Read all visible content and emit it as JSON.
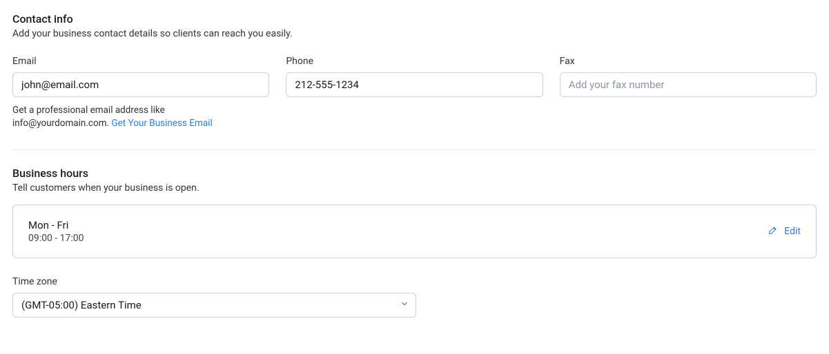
{
  "contact": {
    "title": "Contact info",
    "desc": "Add your business contact details so clients can reach you easily.",
    "email": {
      "label": "Email",
      "value": "john@email.com",
      "helper_prefix": "Get a professional email address like info@yourdomain.com. ",
      "helper_link": "Get Your Business Email"
    },
    "phone": {
      "label": "Phone",
      "value": "212-555-1234"
    },
    "fax": {
      "label": "Fax",
      "placeholder": "Add your fax number",
      "value": ""
    }
  },
  "hours": {
    "title": "Business hours",
    "desc": "Tell customers when your business is open.",
    "days": "Mon - Fri",
    "time": "09:00 - 17:00",
    "edit_label": "Edit"
  },
  "timezone": {
    "label": "Time zone",
    "value": "(GMT-05:00) Eastern Time"
  }
}
